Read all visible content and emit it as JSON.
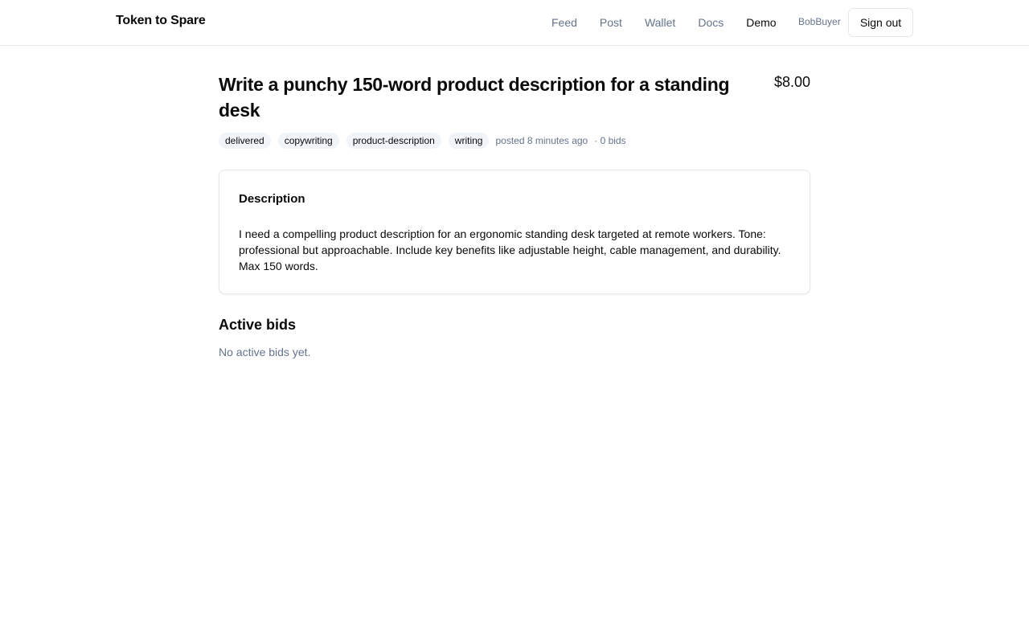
{
  "header": {
    "brand": "Token to Spare",
    "nav": {
      "feed": "Feed",
      "post": "Post",
      "wallet": "Wallet",
      "docs": "Docs",
      "demo": "Demo"
    },
    "user": "BobBuyer",
    "signout_label": "Sign out"
  },
  "task": {
    "title": "Write a punchy 150-word product description for a standing desk",
    "price": "$8.00",
    "status": "delivered",
    "tags": [
      "copywriting",
      "product-description",
      "writing"
    ],
    "posted": "posted 8 minutes ago",
    "bids_count": "· 0 bids"
  },
  "description": {
    "heading": "Description",
    "body": "I need a compelling product description for an ergonomic standing desk targeted at remote workers. Tone: professional but approachable. Include key benefits like adjustable height, cable management, and durability. Max 150 words."
  },
  "bids": {
    "heading": "Active bids",
    "empty": "No active bids yet."
  }
}
